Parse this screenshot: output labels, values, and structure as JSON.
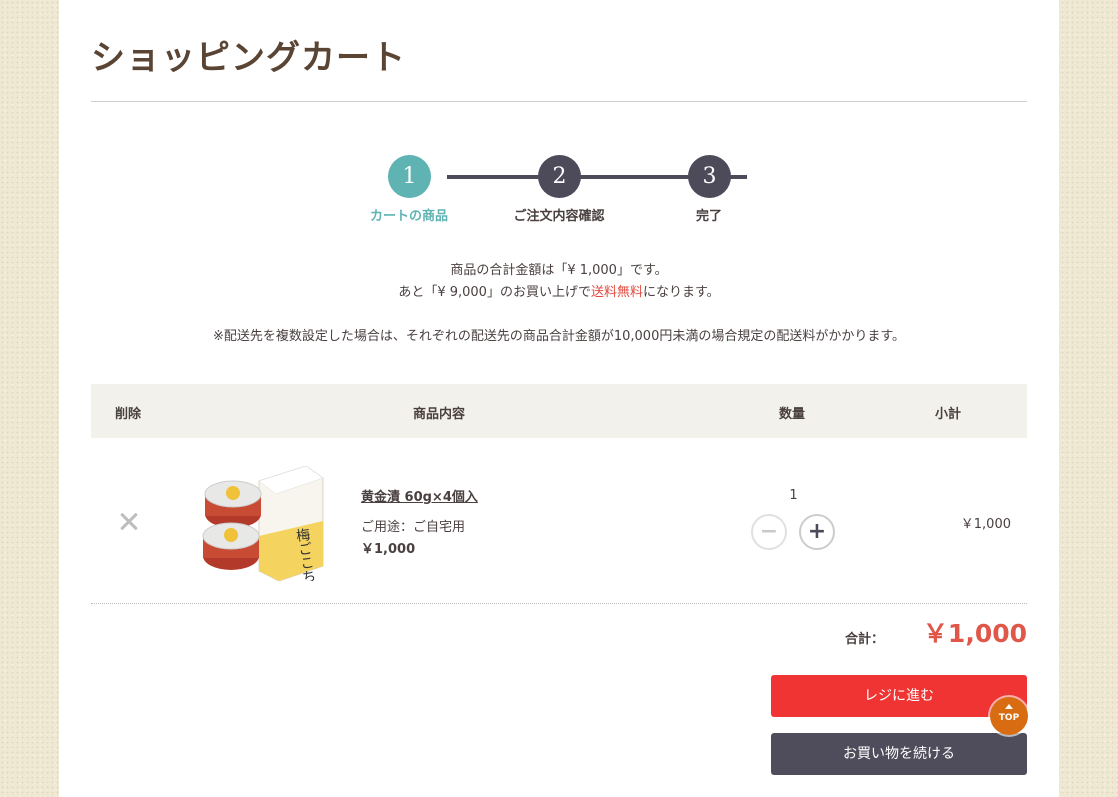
{
  "page": {
    "title": "ショッピングカート"
  },
  "steps": [
    {
      "number": "1",
      "label": "カートの商品",
      "active": true
    },
    {
      "number": "2",
      "label": "ご注文内容確認",
      "active": false
    },
    {
      "number": "3",
      "label": "完了",
      "active": false
    }
  ],
  "info": {
    "line1": "商品の合計金額は「¥ 1,000」です。",
    "line2_prefix": "あと「¥ 9,000」のお買い上げで",
    "line2_highlight": "送料無料",
    "line2_suffix": "になります。",
    "note": "※配送先を複数設定した場合は、それぞれの配送先の商品合計金額が10,000円未満の場合規定の配送料がかかります。"
  },
  "table": {
    "headers": {
      "delete": "削除",
      "product": "商品内容",
      "quantity": "数量",
      "subtotal": "小計"
    },
    "items": [
      {
        "name": "黄金漬 60g×4個入",
        "usage": "ご用途：ご自宅用",
        "price": "￥1,000",
        "quantity": "1",
        "subtotal": "￥1,000",
        "image_label": "梅ごこち"
      }
    ]
  },
  "totals": {
    "label": "合計：",
    "value": "￥1,000"
  },
  "buttons": {
    "checkout": "レジに進む",
    "continue": "お買い物を続ける",
    "top": "TOP"
  },
  "colors": {
    "accent": "#5fb3b3",
    "step": "#4d4b59",
    "checkout": "#f03333",
    "total": "#e0574a",
    "top": "#d86c12"
  }
}
